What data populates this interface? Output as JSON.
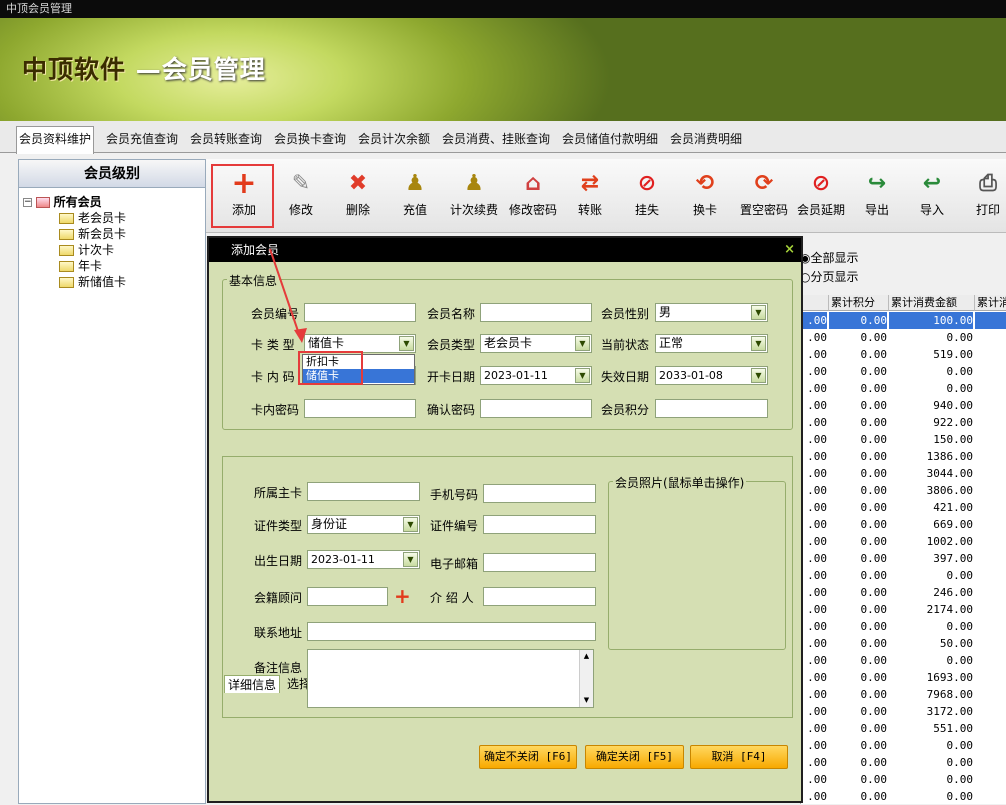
{
  "window": {
    "title": "中顶会员管理"
  },
  "banner": {
    "brand": "中顶软件",
    "subtitle": "—会员管理"
  },
  "tabs": [
    "会员资料维护",
    "会员充值查询",
    "会员转账查询",
    "会员换卡查询",
    "会员计次余额",
    "会员消费、挂账查询",
    "会员储值付款明细",
    "会员消费明细"
  ],
  "left": {
    "header": "会员级别",
    "root": "所有会员",
    "items": [
      "老会员卡",
      "新会员卡",
      "计次卡",
      "年卡",
      "新储值卡"
    ]
  },
  "toolbar": {
    "items": [
      {
        "label": "添加",
        "icon": "add-icon"
      },
      {
        "label": "修改",
        "icon": "wrench-icon"
      },
      {
        "label": "删除",
        "icon": "delete-icon"
      },
      {
        "label": "充值",
        "icon": "recharge-icon"
      },
      {
        "label": "计次续费",
        "icon": "renew-icon"
      },
      {
        "label": "修改密码",
        "icon": "house-key-icon"
      },
      {
        "label": "转账",
        "icon": "transfer-icon"
      },
      {
        "label": "挂失",
        "icon": "ban-icon"
      },
      {
        "label": "换卡",
        "icon": "swap-icon"
      },
      {
        "label": "置空密码",
        "icon": "reset-icon"
      },
      {
        "label": "会员延期",
        "icon": "ban-icon"
      },
      {
        "label": "导出",
        "icon": "export-icon"
      },
      {
        "label": "导入",
        "icon": "import-icon"
      },
      {
        "label": "打印",
        "icon": "print-icon"
      }
    ]
  },
  "view_options": {
    "all": "全部显示",
    "paged": "分页显示"
  },
  "grid": {
    "col1": "累计积分",
    "col2": "累计消费金额",
    "col3": "累计消",
    "rows": [
      [
        "100.00"
      ],
      [
        "0.00"
      ],
      [
        "519.00"
      ],
      [
        "0.00"
      ],
      [
        "0.00"
      ],
      [
        "940.00"
      ],
      [
        "922.00"
      ],
      [
        "150.00"
      ],
      [
        "1386.00"
      ],
      [
        "3044.00"
      ],
      [
        "3806.00"
      ],
      [
        "421.00"
      ],
      [
        "669.00"
      ],
      [
        "1002.00"
      ],
      [
        "397.00"
      ],
      [
        "0.00"
      ],
      [
        "246.00"
      ],
      [
        "2174.00"
      ],
      [
        "0.00"
      ],
      [
        "50.00"
      ],
      [
        "0.00"
      ],
      [
        "1693.00"
      ],
      [
        "7968.00"
      ],
      [
        "3172.00"
      ],
      [
        "551.00"
      ],
      [
        "0.00"
      ],
      [
        "0.00"
      ],
      [
        "0.00"
      ],
      [
        "0.00"
      ]
    ],
    "prefix": ".00",
    "score": "0.00"
  },
  "dialog": {
    "title": "添加会员",
    "close": "×",
    "basic": {
      "legend": "基本信息",
      "member_no_label": "会员编号",
      "member_name_label": "会员名称",
      "gender_label": "会员性别",
      "gender": "男",
      "card_type_label": "卡 类 型",
      "card_type": "储值卡",
      "member_type_label": "会员类型",
      "member_type": "老会员卡",
      "status_label": "当前状态",
      "status": "正常",
      "card_code_label": "卡 内 码",
      "open_date_label": "开卡日期",
      "open_date": "2023-01-11",
      "expire_label": "失效日期",
      "expire_date": "2033-01-08",
      "password_label": "卡内密码",
      "confirm_label": "确认密码",
      "points_label": "会员积分",
      "dropdown": [
        "折扣卡",
        "储值卡"
      ]
    },
    "detail_tabs": [
      "详细信息",
      "选择次卡套餐"
    ],
    "detail": {
      "main_card_label": "所属主卡",
      "phone_label": "手机号码",
      "id_type_label": "证件类型",
      "id_type": "身份证",
      "id_no_label": "证件编号",
      "birth_label": "出生日期",
      "birth": "2023-01-11",
      "email_label": "电子邮箱",
      "advisor_label": "会籍顾问",
      "referrer_label": "介 绍 人",
      "address_label": "联系地址",
      "remark_label": "备注信息",
      "photo_legend": "会员照片(鼠标单击操作)"
    },
    "buttons": {
      "ok_keep": "确定不关闭 [F6]",
      "ok_close": "确定关闭 [F5]",
      "cancel": "取消 [F4]"
    }
  }
}
